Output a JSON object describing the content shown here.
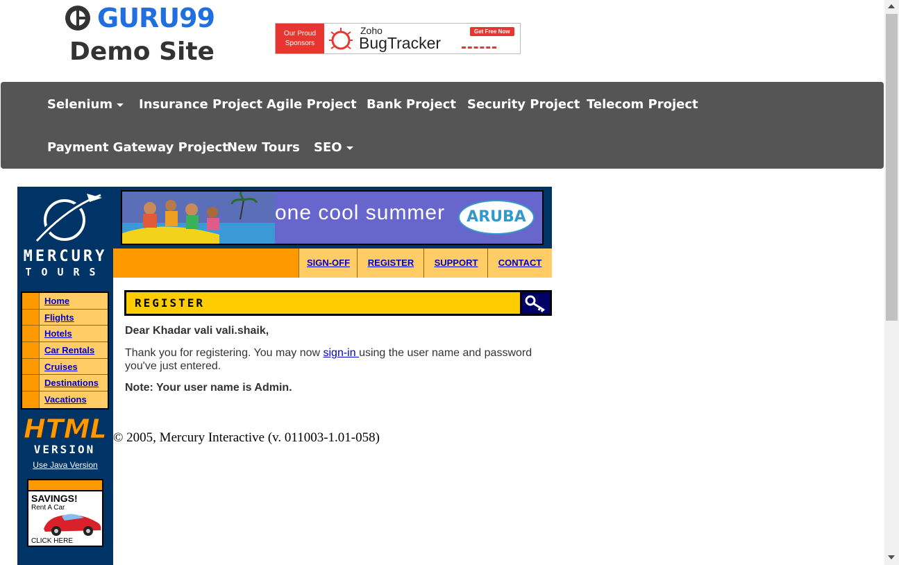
{
  "header": {
    "brand": "GURU99",
    "subtitle": "Demo Site",
    "sponsor": {
      "left_line1": "Our Proud",
      "left_line2": "Sponsors",
      "zoho": "Zoho",
      "product": "BugTracker",
      "cta": "Get Free Now"
    }
  },
  "nav": {
    "items": [
      {
        "label": "Selenium",
        "dropdown": true
      },
      {
        "label": "Insurance Project"
      },
      {
        "label": "Agile Project"
      },
      {
        "label": "Bank Project"
      },
      {
        "label": "Security Project"
      },
      {
        "label": "Telecom Project"
      },
      {
        "label": "Payment Gateway Project"
      },
      {
        "label": "New Tours"
      },
      {
        "label": "SEO",
        "dropdown": true
      }
    ]
  },
  "mercury": {
    "logo_word1": "MERCURY",
    "logo_word2": "TOURS",
    "side_menu": [
      "Home",
      "Flights",
      "Hotels",
      "Car Rentals",
      "Cruises",
      "Destinations",
      "Vacations"
    ],
    "html_badge": "HTML",
    "version_badge": "VERSION",
    "java_link": "Use Java Version",
    "savings_title": "SAVINGS!",
    "savings_sub": "Rent A Car",
    "savings_click": "CLICK HERE",
    "banner_text": "one cool summer",
    "banner_logo": "ARUBA",
    "top_nav": [
      "SIGN-OFF",
      "REGISTER",
      "SUPPORT",
      "CONTACT"
    ],
    "section_title": "REGISTER",
    "greeting": "Dear Khadar vali vali.shaik,",
    "thanks_before": "Thank you for registering. You may now ",
    "signin_link": "sign-in ",
    "thanks_after": "using the user name and password you've just entered.",
    "note": "Note: Your user name is Admin.",
    "copyright": "© 2005, Mercury Interactive (v. 011003-1.01-058)"
  },
  "colors": {
    "nav_bg": "#555555",
    "brand_blue": "#1f6fe0",
    "mercury_navy": "#003366",
    "mercury_orange": "#ff9900",
    "link_blue": "#0000cc"
  }
}
